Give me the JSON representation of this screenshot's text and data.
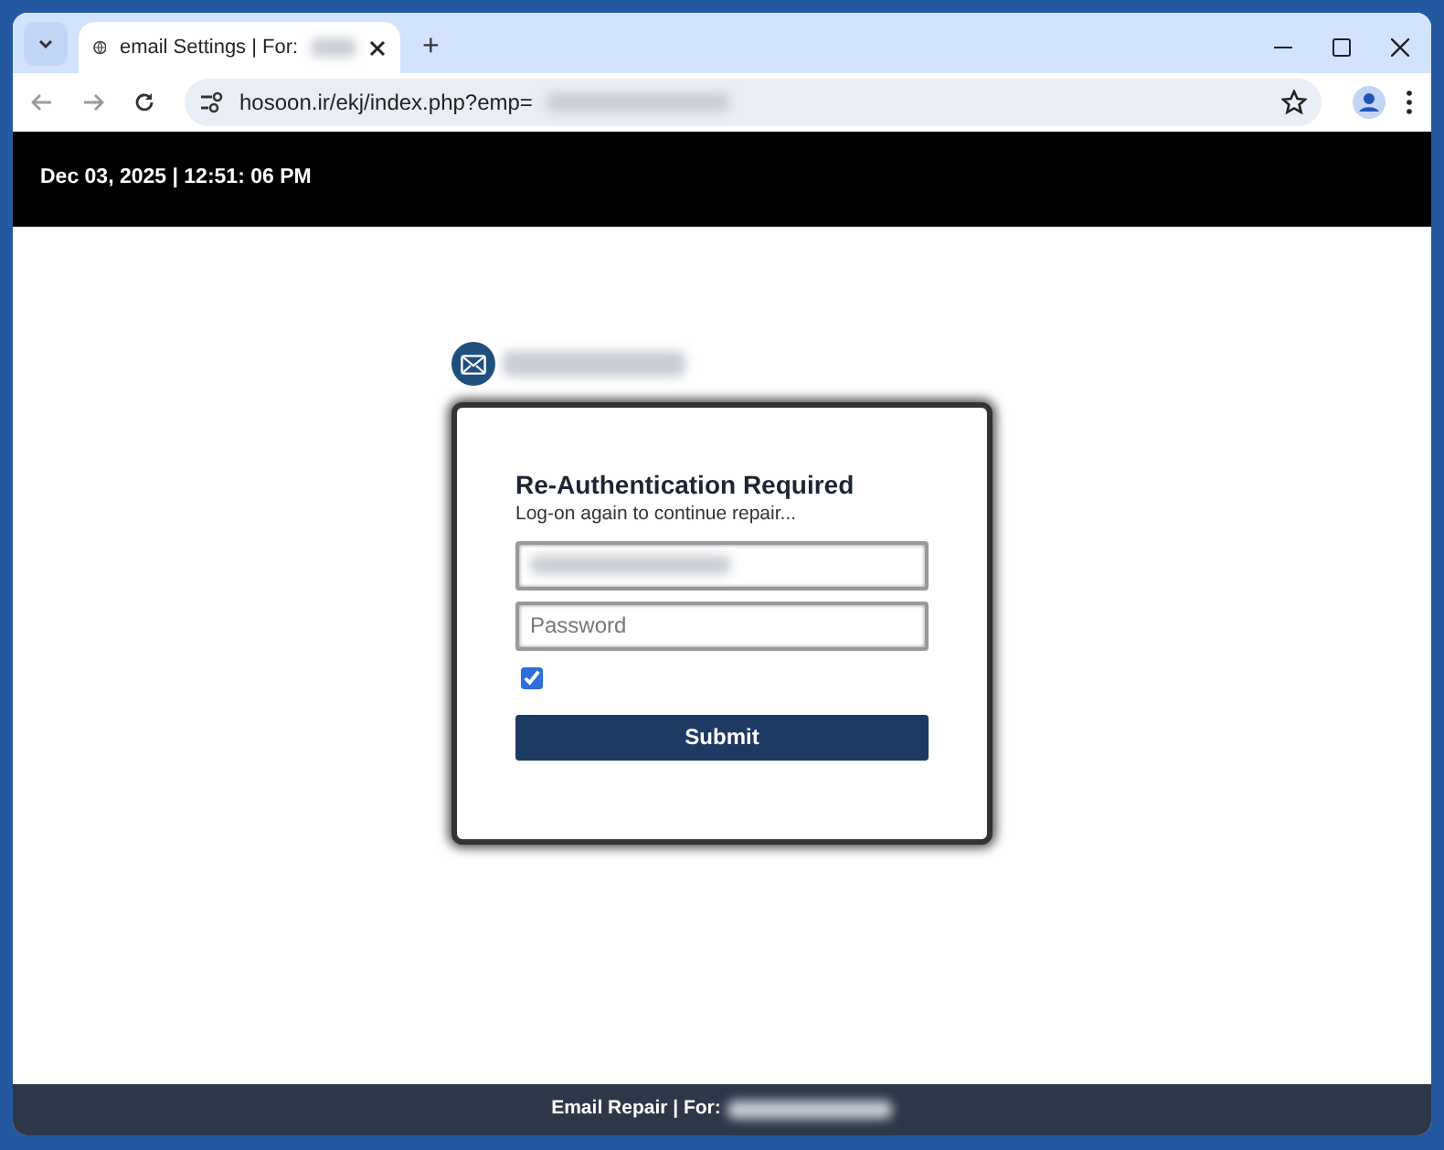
{
  "browser": {
    "tab_title": "email Settings | For:",
    "new_tab": "+",
    "address": "hosoon.ir/ekj/index.php?emp="
  },
  "header": {
    "datetime": "Dec 03, 2025 | 12:51: 06 PM"
  },
  "form": {
    "title": "Re-Authentication Required",
    "subtitle": "Log-on again to continue repair...",
    "password": {
      "placeholder": "Password"
    },
    "checkbox": {
      "checked": true
    },
    "submit": "Submit"
  },
  "footer": {
    "text": "Email Repair | For:"
  }
}
